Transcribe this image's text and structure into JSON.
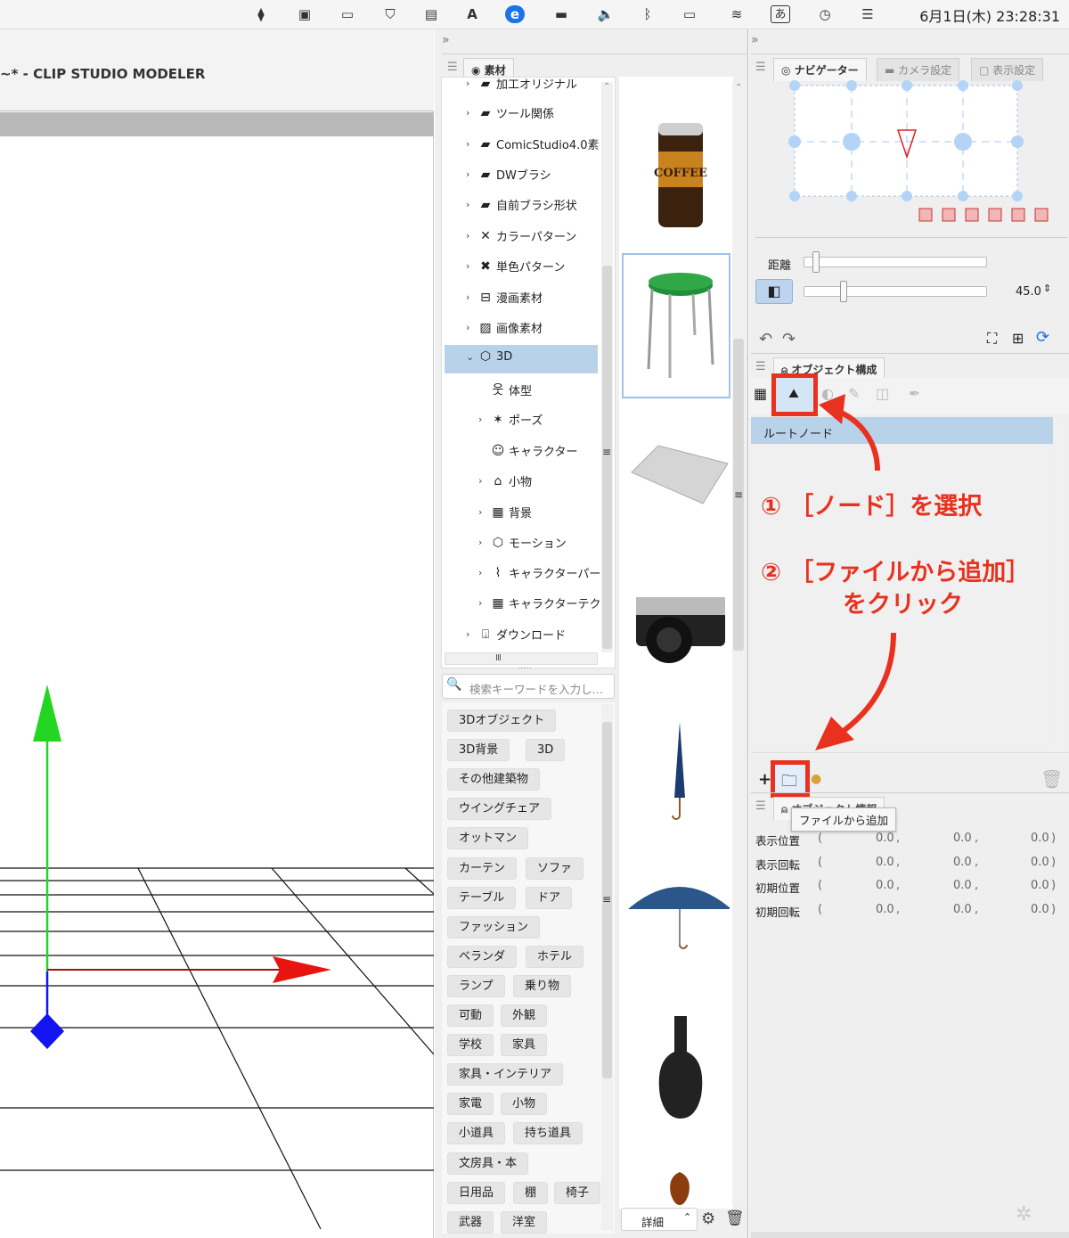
{
  "menubar": {
    "icons": [
      "dropbox-icon",
      "screen-mirror-icon",
      "display-icon",
      "shield-icon",
      "clipboard-icon",
      "a-icon",
      "e-icon",
      "battery-toggle-icon",
      "volume-icon",
      "bluetooth-icon",
      "battery-icon",
      "wifi-icon",
      "input-method-icon",
      "time-machine-icon",
      "control-center-icon"
    ],
    "input_method": "あ",
    "clock": "6月1日(木) 23:28:31"
  },
  "viewport": {
    "title": "~* - CLIP STUDIO MODELER"
  },
  "material_panel": {
    "collapse_glyph": "»",
    "tab_label": "素材",
    "tree": [
      {
        "label": "加工オリジナル",
        "icon": "folder-icon",
        "level": 0
      },
      {
        "label": "ツール関係",
        "icon": "folder-icon",
        "level": 0
      },
      {
        "label": "ComicStudio4.0素",
        "icon": "folder-icon",
        "level": 0
      },
      {
        "label": "DWブラシ",
        "icon": "folder-icon",
        "level": 0
      },
      {
        "label": "自前ブラシ形状",
        "icon": "folder-icon",
        "level": 0
      },
      {
        "label": "カラーパターン",
        "icon": "color-pattern-icon",
        "level": 0
      },
      {
        "label": "単色パターン",
        "icon": "mono-pattern-icon",
        "level": 0
      },
      {
        "label": "漫画素材",
        "icon": "manga-icon",
        "level": 0
      },
      {
        "label": "画像素材",
        "icon": "image-icon",
        "level": 0
      },
      {
        "label": "3D",
        "icon": "cube-icon",
        "level": 0,
        "selected": true,
        "expanded": true
      },
      {
        "label": "体型",
        "icon": "body-icon",
        "level": 1
      },
      {
        "label": "ポーズ",
        "icon": "pose-icon",
        "level": 1
      },
      {
        "label": "キャラクター",
        "icon": "character-icon",
        "level": 1
      },
      {
        "label": "小物",
        "icon": "bag-icon",
        "level": 1
      },
      {
        "label": "背景",
        "icon": "building-icon",
        "level": 1
      },
      {
        "label": "モーション",
        "icon": "motion-icon",
        "level": 1
      },
      {
        "label": "キャラクターパー",
        "icon": "character-part-icon",
        "level": 1
      },
      {
        "label": "キャラクターテク",
        "icon": "texture-icon",
        "level": 1
      },
      {
        "label": "ダウンロード",
        "icon": "download-icon",
        "level": 0
      }
    ],
    "search_placeholder": "検索キーワードを入力し…",
    "tags": [
      [
        "3Dオブジェクト"
      ],
      [
        "3D背景",
        "3D"
      ],
      [
        "その他建築物"
      ],
      [
        "ウイングチェア"
      ],
      [
        "オットマン"
      ],
      [
        "カーテン",
        "ソファ"
      ],
      [
        "テーブル",
        "ドア"
      ],
      [
        "ファッション"
      ],
      [
        "ベランダ",
        "ホテル"
      ],
      [
        "ランプ",
        "乗り物"
      ],
      [
        "可動",
        "外観"
      ],
      [
        "学校",
        "家具"
      ],
      [
        "家具・インテリア"
      ],
      [
        "家電",
        "小物"
      ],
      [
        "小道具",
        "持ち道具"
      ],
      [
        "文房具・本"
      ],
      [
        "日用品",
        "棚",
        "椅子"
      ],
      [
        "武器",
        "洋室"
      ]
    ],
    "thumbnails": [
      "coffee-can-thumbnail",
      "stool-thumbnail",
      "tray-thumbnail",
      "camera-thumbnail",
      "closed-umbrella-thumbnail",
      "open-umbrella-thumbnail",
      "guitar-case-thumbnail",
      "violin-thumbnail"
    ],
    "coffee_label": "COFFEE",
    "detail_select": "詳細"
  },
  "navigator_panel": {
    "collapse_glyph": "»",
    "tabs": [
      "ナビゲーター",
      "カメラ設定",
      "表示設定"
    ],
    "distance_label": "距離",
    "distance_value": 0.05,
    "angle_value_num": 0.2,
    "angle_value": "45.0"
  },
  "object_panel": {
    "tab_label": "オブジェクト構成",
    "root_node": "ルートノード",
    "annotation_1": "① ［ノード］を選択",
    "annotation_2a": "② ［ファイルから追加］",
    "annotation_2b": "をクリック",
    "tooltip": "ファイルから追加"
  },
  "object_info": {
    "tab_label": "オブジェクト情報",
    "rows": [
      {
        "label": "表示位置",
        "x": "0.0",
        "y": "0.0",
        "z": "0.0"
      },
      {
        "label": "表示回転",
        "x": "0.0",
        "y": "0.0",
        "z": "0.0"
      },
      {
        "label": "初期位置",
        "x": "0.0",
        "y": "0.0",
        "z": "0.0"
      },
      {
        "label": "初期回転",
        "x": "0.0",
        "y": "0.0",
        "z": "0.0"
      }
    ]
  },
  "colors": {
    "accent_red": "#e8321f",
    "selection_blue": "#b8d2ea",
    "axis_green": "#22d622",
    "axis_red": "#e8140f",
    "axis_blue": "#1414f0"
  }
}
